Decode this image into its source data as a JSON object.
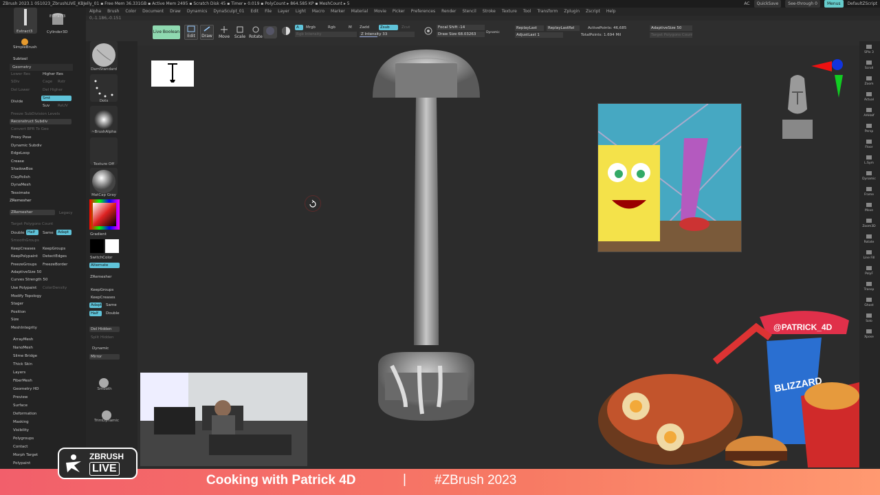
{
  "titlebar": {
    "text": "ZBrush 2023.1   051023_ZbrushLIVE_KBJelly_01   ▪ Free Mem 36.331GB ▪ Active Mem 2495 ▪ Scratch Disk 45 ▪ Timer ▸ 0.019 ▪ PolyCount ▸ 864.585 KP ▪ MeshCount ▸ 5",
    "ac": "AC",
    "quicksave": "QuickSave",
    "seethrough": "See-through  0",
    "menus": "Menus",
    "defaultzscript": "DefaultZScript"
  },
  "menubar": [
    "Alpha",
    "Brush",
    "Color",
    "Document",
    "Draw",
    "Dynamics",
    "DynaSculpt_01",
    "Edit",
    "File",
    "Layer",
    "Light",
    "Macro",
    "Marker",
    "Material",
    "Movie",
    "Picker",
    "Preferences",
    "Render",
    "Stencil",
    "Stroke",
    "Texture",
    "Tool",
    "Transform",
    "Zplugin",
    "Zscript",
    "Help"
  ],
  "coords": "0,-1.186,-0.151",
  "toolbar": {
    "live_boolean": "Live Boolean",
    "edit": "Edit",
    "draw": "Draw",
    "move": "Move",
    "scale": "Scale",
    "rotate": "Rotate",
    "a": "A",
    "mrgb": "Mrgb",
    "rgb": "Rgb",
    "m": "M",
    "zadd": "Zadd",
    "zsub": "Zsub",
    "zcut": "Zcut",
    "rgb_intensity": "Rgb Intensity",
    "z_intensity": "Z Intensity 33",
    "focal_shift": "Focal Shift -14",
    "draw_size": "Draw Size 68.03263",
    "dynamic": "Dynamic",
    "replay_last": "ReplayLast",
    "replay_last_rel": "ReplayLastRel",
    "adjust_last": "AdjustLast 1",
    "active_points": "ActivePoints: 46,685",
    "total_points": "TotalPoints: 1.694 Mil",
    "adaptive_size": "AdaptiveSize 50",
    "target_polygons": "Target Polygons Count"
  },
  "leftpanel": {
    "top_tools": [
      "Extract3",
      "Cylinder3D",
      "SimpleBrush",
      "Extract3"
    ],
    "subtool": "Subtool",
    "geometry": "Geometry",
    "lower_res": "Lower Res",
    "higher_res": "Higher Res",
    "sdiv": "SDiv",
    "cage": "Cage",
    "rstr": "Rstr",
    "del_lower": "Del Lower",
    "del_higher": "Del Higher",
    "divide": "Divide",
    "smt": "Smt",
    "suv": "Suv",
    "reuv": "ReUV",
    "freeze_subdiv": "Freeze SubDivision Levels",
    "reconstruct_subdiv": "Reconstruct Subdiv",
    "convert_bpr": "Convert BPR To Geo",
    "items_a": [
      "Proxy Pose",
      "Dynamic Subdiv",
      "EdgeLoop",
      "Crease",
      "ShadowBox",
      "ClayPolish",
      "DynaMesh",
      "Tessimate",
      "ZRemesher"
    ],
    "zremesher_btn": "ZRemesher",
    "legacy": "Legacy",
    "target_poly": "Target Polygons Count",
    "double": "Double",
    "half": "Half",
    "same": "Same",
    "adapt": "Adapt",
    "smooth_groups": "SmoothGroups",
    "keep_creases": "KeepCreases",
    "keep_groups": "KeepGroups",
    "keep_polypaint": "KeepPolypaint",
    "detect_edges": "DetectEdges",
    "freeze_groups": "FreezeGroups",
    "freeze_border": "FreezeBorder",
    "adaptive_size": "AdaptiveSize 50",
    "curves_strength": "Curves Strength 50",
    "use_polypaint": "Use Polypaint",
    "color_density": "ColorDensity",
    "items_b": [
      "Modify Topology",
      "Stager",
      "Position",
      "Size",
      "MeshIntegrity"
    ],
    "items_c": [
      "ArrayMesh",
      "NanoMesh",
      "Slime Bridge",
      "Thick Skin",
      "Layers",
      "FiberMesh",
      "Geometry HD",
      "Preview",
      "Surface",
      "Deformation",
      "Masking",
      "Visibility",
      "Polygroups",
      "Contact",
      "Morph Target",
      "Polypaint"
    ]
  },
  "brushcol": {
    "dam_standard": "DamStandard",
    "dots": "Dots",
    "brush_alpha": "~BrushAlpha",
    "texture_off": "Texture Off",
    "matcap": "MatCap Gray",
    "gradient": "Gradient",
    "switch_color": "SwitchColor",
    "alternate": "Alternate",
    "zremesher": "ZRemesher",
    "keep_groups": "KeepGroups",
    "keep_creases": "KeepCreases",
    "adapt": "Adapt",
    "same": "Same",
    "half": "Half",
    "double": "Double",
    "del_hidden": "Del Hidden",
    "split_hidden": "Split Hidden",
    "dynamic": "Dynamic",
    "mirror": "Mirror",
    "smooth": "Smooth",
    "trim_dynamic": "TrimDynamic"
  },
  "rightbar": [
    "SPix 3",
    "Scroll",
    "Zoom",
    "Actual",
    "AAHalf",
    "Persp",
    "Floor",
    "L.Sym",
    "Dynamic",
    "Frame",
    "Move",
    "Zoom3D",
    "Rotate",
    "Line Fill",
    "PolyF",
    "Transp",
    "Ghost",
    "Solo",
    "Xpose"
  ],
  "overlay": {
    "stream_title": "Cooking with Patrick 4D",
    "separator": "|",
    "hashtag": "#ZBrush 2023",
    "zbrush": "ZBRUSH",
    "live": "LIVE",
    "patrick_tag": "@PATRICK_4D",
    "blizzard": "BLIZZARD"
  },
  "colors": {
    "accent": "#5fc3d9",
    "live_boolean": "#8fd9b0",
    "banner": "#f25f6b",
    "viewport": "#2c2c2c"
  }
}
